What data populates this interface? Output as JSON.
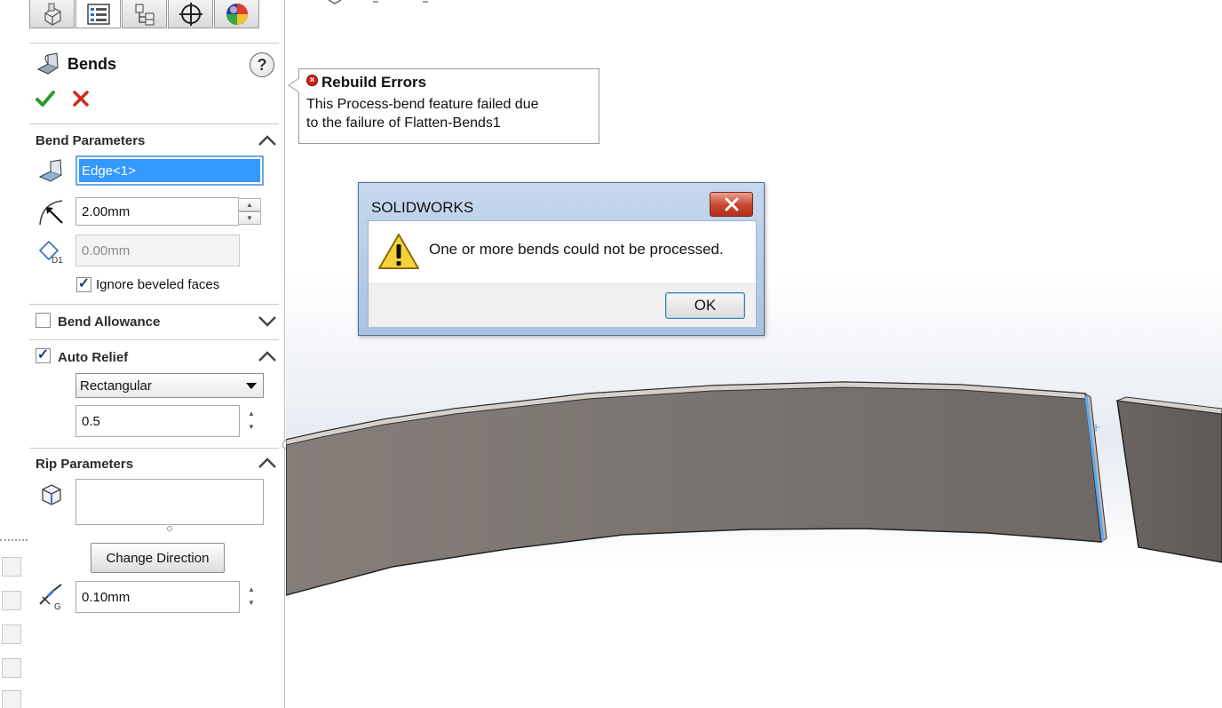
{
  "property_manager": {
    "tabs": [
      {
        "icon": "feature-manager-icon"
      },
      {
        "icon": "property-manager-icon",
        "active": true
      },
      {
        "icon": "configuration-manager-icon"
      },
      {
        "icon": "dimxpert-manager-icon"
      },
      {
        "icon": "display-manager-icon"
      }
    ],
    "title": "Bends",
    "help_label": "?",
    "bend_parameters": {
      "header": "Bend Parameters",
      "fixed_face_value": "Edge<1>",
      "bend_radius": "2.00mm",
      "k_factor_disabled": "0.00mm",
      "ignore_beveled_label": "Ignore beveled faces",
      "ignore_beveled_checked": true
    },
    "bend_allowance": {
      "header": "Bend Allowance",
      "checked": false
    },
    "auto_relief": {
      "header": "Auto Relief",
      "checked": true,
      "type": "Rectangular",
      "ratio": "0.5"
    },
    "rip_parameters": {
      "header": "Rip Parameters",
      "edges_value": "",
      "change_direction_label": "Change Direction",
      "gap": "0.10mm"
    }
  },
  "rebuild_errors": {
    "title": "Rebuild Errors",
    "line1": "This Process-bend feature failed due",
    "line2": "to the failure of Flatten-Bends1"
  },
  "dialog": {
    "title": "SOLIDWORKS",
    "message": "One or more bends could not be processed.",
    "ok_label": "OK"
  },
  "colors": {
    "selection_blue": "#3399ff",
    "part_face": "#7f7872",
    "part_edge_highlight": "#5aa8f0",
    "dialog_frame": "#b4cbe7",
    "close_red": "#c8452f",
    "check_green": "#2e9a2e",
    "cancel_red": "#d22a1e"
  }
}
